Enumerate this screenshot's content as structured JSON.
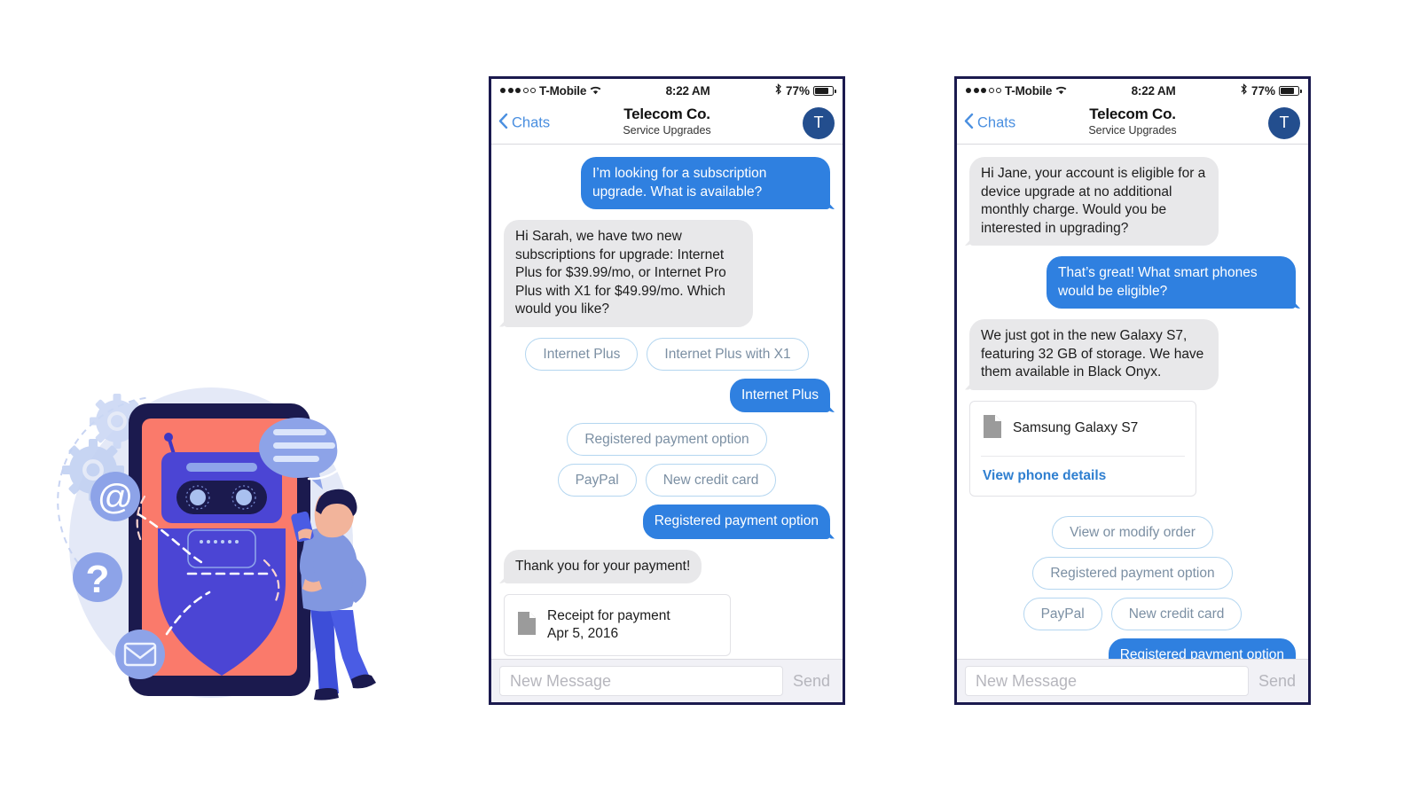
{
  "illustration": {
    "name": "chatbot-assistant-illustration",
    "icons": [
      "at-sign-icon",
      "question-mark-icon",
      "envelope-icon",
      "gear-icon",
      "speech-bubble-icon"
    ],
    "colors": {
      "backdrop": "#e4e9f7",
      "tablet_frame": "#1b1a4e",
      "tablet_screen": "#fa7a6b",
      "robot": "#4b45d4",
      "badge": "#8da3e8",
      "person_shirt": "#8197e0",
      "person_pants": "#3d4ed8"
    }
  },
  "statusbar": {
    "carrier": "T-Mobile",
    "time": "8:22 AM",
    "battery_pct": "77%",
    "wifi_icon": "wifi-icon",
    "bluetooth_icon": "bluetooth-icon",
    "battery_icon": "battery-icon",
    "signal_icon": "signal-dots-icon"
  },
  "navbar": {
    "back_label": "Chats",
    "title": "Telecom Co.",
    "subtitle": "Service Upgrades",
    "avatar_initial": "T",
    "back_icon": "chevron-left-icon"
  },
  "composer": {
    "placeholder": "New Message",
    "value": "",
    "send_label": "Send"
  },
  "colors": {
    "outgoing_bubble": "#2f80e0",
    "incoming_bubble": "#e8e8ea",
    "chip_border": "#b4d6f0",
    "chip_text": "#7b8fa3",
    "link": "#2f7fd0",
    "accent_blue": "#4a8fe0",
    "avatar_bg": "#234e8e",
    "phone_frame": "#1b1a4e"
  },
  "phone_left": {
    "name": "subscription-upgrade-conversation",
    "messages": [
      {
        "id": "m1",
        "dir": "out",
        "text": "I’m looking for a subscription upgrade. What is available?"
      },
      {
        "id": "m2",
        "dir": "in",
        "text": "Hi Sarah, we have two new subscriptions for upgrade: Internet Plus for $39.99/mo, or Internet Pro Plus with X1 for $49.99/mo. Which would you like?"
      }
    ],
    "chips_plan": [
      "Internet Plus",
      "Internet Plus with X1"
    ],
    "reply_plan": "Internet Plus",
    "chips_payment_row1": [
      "Registered payment option"
    ],
    "chips_payment_row2": [
      "PayPal",
      "New credit card"
    ],
    "reply_payment": "Registered payment option",
    "thanks": "Thank you for your payment!",
    "receipt_card": {
      "title": "Receipt for payment",
      "date": "Apr 5, 2016",
      "icon": "document-icon"
    }
  },
  "phone_right": {
    "name": "device-upgrade-conversation",
    "messages": [
      {
        "id": "r1",
        "dir": "in",
        "text": "Hi Jane, your account is eligible for a device upgrade at no additional monthly charge. Would you be interested in upgrading?"
      },
      {
        "id": "r2",
        "dir": "out",
        "text": "That’s great! What smart phones would be eligible?"
      },
      {
        "id": "r3",
        "dir": "in",
        "text": "We just got in the new Galaxy S7, featuring 32 GB of storage. We have them available in Black Onyx."
      }
    ],
    "phone_card": {
      "title": "Samsung Galaxy S7",
      "action": "View phone details",
      "icon": "document-icon"
    },
    "chips_order": [
      "View or modify order"
    ],
    "chips_payment_row1": [
      "Registered payment option"
    ],
    "chips_payment_row2": [
      "PayPal",
      "New credit card"
    ],
    "reply_payment": "Registered payment option"
  }
}
